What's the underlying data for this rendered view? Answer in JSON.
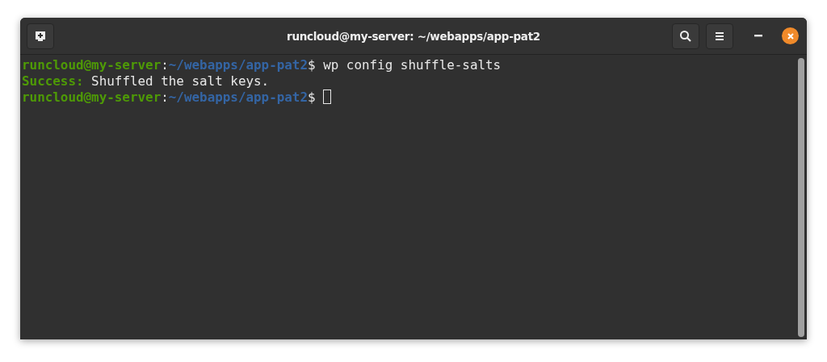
{
  "window": {
    "title": "runcloud@my-server: ~/webapps/app-pat2"
  },
  "terminal": {
    "lines": [
      {
        "cursor": false,
        "segments": [
          {
            "kind": "user",
            "text": "runcloud@my-server"
          },
          {
            "kind": "plain",
            "text": ":"
          },
          {
            "kind": "path",
            "text": "~/webapps/app-pat2"
          },
          {
            "kind": "plain",
            "text": "$ wp config shuffle-salts"
          }
        ]
      },
      {
        "cursor": false,
        "segments": [
          {
            "kind": "success",
            "text": "Success:"
          },
          {
            "kind": "plain",
            "text": " Shuffled the salt keys."
          }
        ]
      },
      {
        "cursor": true,
        "segments": [
          {
            "kind": "user",
            "text": "runcloud@my-server"
          },
          {
            "kind": "plain",
            "text": ":"
          },
          {
            "kind": "path",
            "text": "~/webapps/app-pat2"
          },
          {
            "kind": "plain",
            "text": "$ "
          }
        ]
      }
    ]
  }
}
